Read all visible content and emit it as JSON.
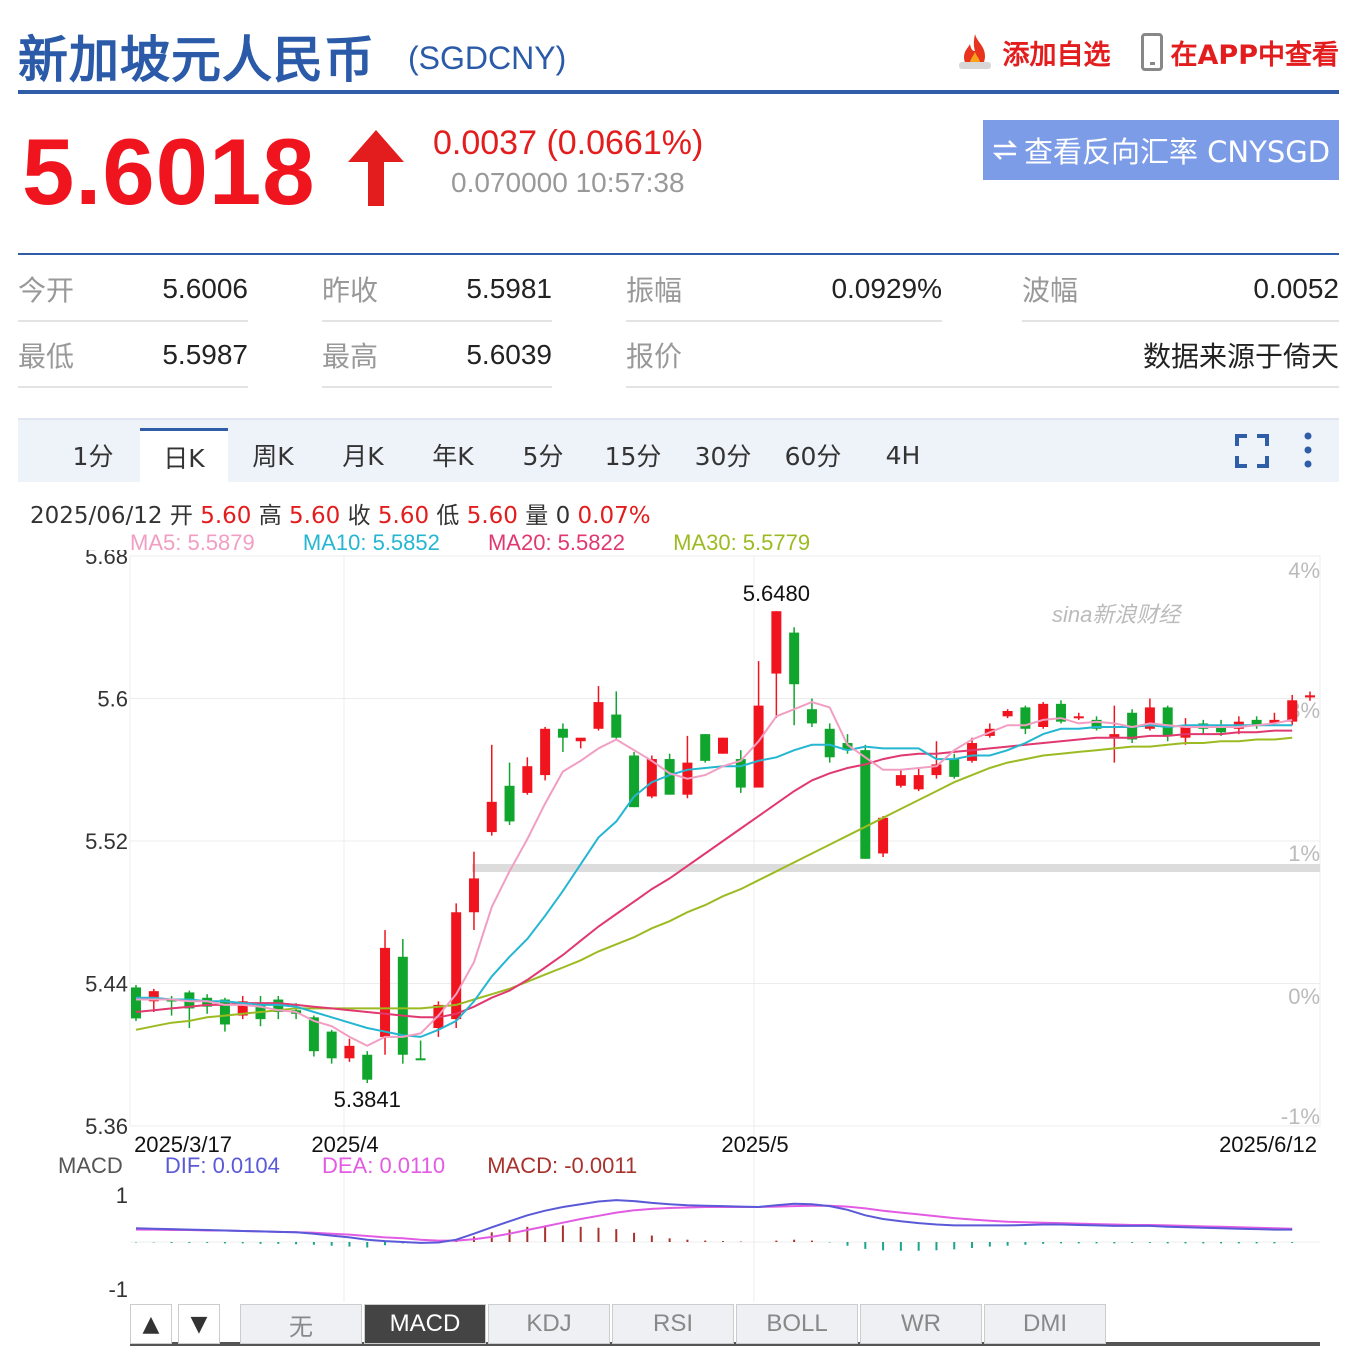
{
  "header": {
    "title": "新加坡元人民币",
    "symbol": "(SGDCNY)",
    "add_watch": "添加自选",
    "view_app": "在APP中查看"
  },
  "quote": {
    "price": "5.6018",
    "change": "0.0037 (0.0661%)",
    "sub": "0.070000 10:57:38",
    "reverse_button": "查看反向汇率 CNYSGD",
    "price_color": "#f0141e"
  },
  "stats": [
    {
      "label": "今开",
      "value": "5.6006"
    },
    {
      "label": "昨收",
      "value": "5.5981"
    },
    {
      "label": "振幅",
      "value": "0.0929%"
    },
    {
      "label": "波幅",
      "value": "0.0052"
    },
    {
      "label": "最低",
      "value": "5.5987"
    },
    {
      "label": "最高",
      "value": "5.6039"
    },
    {
      "label": "报价",
      "value": "数据来源于倚天"
    }
  ],
  "tabs": [
    "1分",
    "日K",
    "周K",
    "月K",
    "年K",
    "5分",
    "15分",
    "30分",
    "60分",
    "4H"
  ],
  "active_tab": "日K",
  "info": {
    "date": "2025/06/12",
    "open_label": "开",
    "open": "5.60",
    "high_label": "高",
    "high": "5.60",
    "close_label": "收",
    "close": "5.60",
    "low_label": "低",
    "low": "5.60",
    "vol_label": "量",
    "vol": "0",
    "pct": "0.07%"
  },
  "ma": {
    "ma5": "MA5: 5.5879",
    "ma10": "MA10: 5.5852",
    "ma20": "MA20: 5.5822",
    "ma30": "MA30: 5.5779",
    "colors": {
      "ma5": "#f19ec2",
      "ma10": "#25b6d2",
      "ma20": "#e0396f",
      "ma30": "#9cbb22"
    }
  },
  "chart_data": {
    "type": "candlestick",
    "y_ticks": [
      "5.68",
      "5.6",
      "5.52",
      "5.44",
      "5.36"
    ],
    "y_tick_values": [
      5.68,
      5.6,
      5.52,
      5.44,
      5.36
    ],
    "pct_ticks": [
      "4%",
      "3%",
      "1%",
      "0%",
      "-1%"
    ],
    "x_ticks": [
      "2025/3/17",
      "2025/4",
      "2025/5",
      "2025/6/12"
    ],
    "ylim": [
      5.36,
      5.68
    ],
    "annotations": {
      "max": "5.6480",
      "min": "5.3841"
    },
    "watermark": "sina新浪财经",
    "up_color": "#f0141e",
    "down_color": "#10a52c",
    "candles": [
      [
        5.4378,
        5.4204,
        5.4392,
        5.419
      ],
      [
        5.43,
        5.4357,
        5.437,
        5.424
      ],
      [
        5.431,
        5.43,
        5.433,
        5.422
      ],
      [
        5.435,
        5.426,
        5.436,
        5.415
      ],
      [
        5.432,
        5.427,
        5.434,
        5.423
      ],
      [
        5.431,
        5.417,
        5.432,
        5.413
      ],
      [
        5.422,
        5.43,
        5.433,
        5.42
      ],
      [
        5.429,
        5.42,
        5.433,
        5.416
      ],
      [
        5.431,
        5.424,
        5.433,
        5.42
      ],
      [
        5.425,
        5.423,
        5.429,
        5.42
      ],
      [
        5.421,
        5.402,
        5.422,
        5.399
      ],
      [
        5.413,
        5.398,
        5.414,
        5.395
      ],
      [
        5.398,
        5.405,
        5.409,
        5.396
      ],
      [
        5.4,
        5.386,
        5.402,
        5.3841
      ],
      [
        5.41,
        5.46,
        5.47,
        5.4
      ],
      [
        5.455,
        5.4,
        5.465,
        5.395
      ],
      [
        5.398,
        5.397,
        5.408,
        5.397
      ],
      [
        5.415,
        5.428,
        5.43,
        5.41
      ],
      [
        5.42,
        5.48,
        5.485,
        5.415
      ],
      [
        5.48,
        5.499,
        5.514,
        5.47
      ],
      [
        5.525,
        5.542,
        5.574,
        5.523
      ],
      [
        5.551,
        5.531,
        5.564,
        5.529
      ],
      [
        5.547,
        5.562,
        5.567,
        5.546
      ],
      [
        5.557,
        5.583,
        5.584,
        5.554
      ],
      [
        5.583,
        5.578,
        5.586,
        5.57
      ],
      [
        5.576,
        5.578,
        5.577,
        5.572
      ],
      [
        5.583,
        5.598,
        5.607,
        5.582
      ],
      [
        5.591,
        5.578,
        5.604,
        5.577
      ],
      [
        5.568,
        5.539,
        5.57,
        5.539
      ],
      [
        5.545,
        5.566,
        5.568,
        5.544
      ],
      [
        5.566,
        5.546,
        5.569,
        5.546
      ],
      [
        5.546,
        5.564,
        5.579,
        5.544
      ],
      [
        5.58,
        5.565,
        5.58,
        5.564
      ],
      [
        5.569,
        5.578,
        5.578,
        5.569
      ],
      [
        5.566,
        5.55,
        5.571,
        5.547
      ],
      [
        5.55,
        5.596,
        5.621,
        5.55
      ],
      [
        5.614,
        5.649,
        5.649,
        5.589
      ],
      [
        5.637,
        5.608,
        5.64,
        5.585
      ],
      [
        5.594,
        5.586,
        5.6,
        5.584
      ],
      [
        5.583,
        5.567,
        5.586,
        5.564
      ],
      [
        5.575,
        5.571,
        5.58,
        5.569
      ],
      [
        5.571,
        5.51,
        5.574,
        5.51
      ],
      [
        5.513,
        5.533,
        5.534,
        5.511
      ],
      [
        5.551,
        5.557,
        5.56,
        5.55
      ],
      [
        5.549,
        5.557,
        5.561,
        5.548
      ],
      [
        5.557,
        5.563,
        5.576,
        5.555
      ],
      [
        5.566,
        5.556,
        5.569,
        5.555
      ],
      [
        5.565,
        5.575,
        5.578,
        5.564
      ],
      [
        5.579,
        5.583,
        5.586,
        5.578
      ],
      [
        5.59,
        5.593,
        5.594,
        5.589
      ],
      [
        5.595,
        5.583,
        5.596,
        5.58
      ],
      [
        5.584,
        5.597,
        5.598,
        5.583
      ],
      [
        5.597,
        5.587,
        5.599,
        5.586
      ],
      [
        5.589,
        5.59,
        5.592,
        5.588
      ],
      [
        5.588,
        5.583,
        5.59,
        5.582
      ],
      [
        5.578,
        5.58,
        5.596,
        5.564
      ],
      [
        5.592,
        5.577,
        5.594,
        5.575
      ],
      [
        5.583,
        5.595,
        5.6,
        5.582
      ],
      [
        5.595,
        5.579,
        5.596,
        5.576
      ],
      [
        5.578,
        5.585,
        5.589,
        5.574
      ],
      [
        5.586,
        5.583,
        5.588,
        5.58
      ],
      [
        5.585,
        5.581,
        5.588,
        5.579
      ],
      [
        5.583,
        5.587,
        5.59,
        5.58
      ],
      [
        5.588,
        5.585,
        5.59,
        5.583
      ],
      [
        5.586,
        5.588,
        5.592,
        5.585
      ],
      [
        5.587,
        5.599,
        5.602,
        5.585
      ],
      [
        5.6006,
        5.6018,
        5.6039,
        5.5987
      ]
    ],
    "ma5": [
      5.431,
      5.431,
      5.431,
      5.43,
      5.43,
      5.428,
      5.428,
      5.427,
      5.425,
      5.424,
      5.419,
      5.416,
      5.41,
      5.405,
      5.41,
      5.41,
      5.412,
      5.422,
      5.434,
      5.452,
      5.483,
      5.503,
      5.521,
      5.541,
      5.559,
      5.565,
      5.572,
      5.577,
      5.571,
      5.565,
      5.558,
      5.555,
      5.557,
      5.562,
      5.565,
      5.576,
      5.59,
      5.594,
      5.598,
      5.595,
      5.574,
      5.567,
      5.56,
      5.56,
      5.561,
      5.562,
      5.571,
      5.577,
      5.581,
      5.585,
      5.585,
      5.588,
      5.589,
      5.586,
      5.587,
      5.586,
      5.584,
      5.586,
      5.585,
      5.584,
      5.584,
      5.584,
      5.584,
      5.585,
      5.586,
      5.588
    ],
    "ma10": [
      5.432,
      5.432,
      5.431,
      5.431,
      5.43,
      5.43,
      5.429,
      5.428,
      5.428,
      5.427,
      5.424,
      5.421,
      5.418,
      5.415,
      5.413,
      5.411,
      5.41,
      5.414,
      5.419,
      5.43,
      5.444,
      5.455,
      5.465,
      5.478,
      5.492,
      5.507,
      5.522,
      5.531,
      5.545,
      5.553,
      5.557,
      5.56,
      5.561,
      5.562,
      5.562,
      5.565,
      5.567,
      5.571,
      5.574,
      5.574,
      5.571,
      5.573,
      5.572,
      5.572,
      5.572,
      5.566,
      5.566,
      5.568,
      5.568,
      5.571,
      5.575,
      5.58,
      5.583,
      5.583,
      5.584,
      5.584,
      5.584,
      5.585,
      5.584,
      5.585,
      5.585,
      5.585,
      5.585,
      5.585,
      5.585,
      5.585
    ],
    "ma20": [
      5.424,
      5.425,
      5.426,
      5.427,
      5.428,
      5.428,
      5.429,
      5.429,
      5.429,
      5.428,
      5.427,
      5.426,
      5.425,
      5.424,
      5.423,
      5.422,
      5.421,
      5.421,
      5.423,
      5.427,
      5.432,
      5.436,
      5.442,
      5.449,
      5.456,
      5.464,
      5.472,
      5.479,
      5.486,
      5.493,
      5.499,
      5.506,
      5.513,
      5.52,
      5.527,
      5.534,
      5.541,
      5.548,
      5.554,
      5.558,
      5.561,
      5.563,
      5.566,
      5.568,
      5.569,
      5.569,
      5.57,
      5.571,
      5.572,
      5.573,
      5.574,
      5.575,
      5.576,
      5.577,
      5.578,
      5.578,
      5.578,
      5.579,
      5.579,
      5.58,
      5.58,
      5.58,
      5.581,
      5.581,
      5.582,
      5.582
    ],
    "ma30": [
      5.414,
      5.416,
      5.418,
      5.419,
      5.421,
      5.422,
      5.423,
      5.424,
      5.425,
      5.426,
      5.426,
      5.426,
      5.426,
      5.426,
      5.426,
      5.426,
      5.426,
      5.427,
      5.428,
      5.431,
      5.434,
      5.437,
      5.441,
      5.445,
      5.449,
      5.453,
      5.458,
      5.462,
      5.466,
      5.471,
      5.475,
      5.48,
      5.484,
      5.489,
      5.493,
      5.498,
      5.503,
      5.508,
      5.513,
      5.518,
      5.523,
      5.528,
      5.533,
      5.538,
      5.543,
      5.548,
      5.553,
      5.557,
      5.561,
      5.564,
      5.566,
      5.568,
      5.569,
      5.57,
      5.571,
      5.572,
      5.573,
      5.573,
      5.574,
      5.575,
      5.575,
      5.576,
      5.576,
      5.577,
      5.577,
      5.578
    ]
  },
  "macd": {
    "name": "MACD",
    "dif": "DIF: 0.0104",
    "dea": "DEA: 0.0110",
    "macd": "MACD: -0.0011",
    "y_ticks": [
      "1",
      "-1"
    ],
    "colors": {
      "dif": "#5a5ad8",
      "dea": "#e35be3",
      "pos": "#a8322e",
      "neg": "#1aa48b"
    },
    "dif_values": [
      0.3,
      0.29,
      0.28,
      0.27,
      0.26,
      0.25,
      0.24,
      0.23,
      0.22,
      0.21,
      0.18,
      0.14,
      0.1,
      0.05,
      0.02,
      0.0,
      -0.02,
      -0.01,
      0.05,
      0.18,
      0.32,
      0.45,
      0.58,
      0.68,
      0.76,
      0.82,
      0.88,
      0.91,
      0.89,
      0.85,
      0.82,
      0.8,
      0.79,
      0.78,
      0.77,
      0.76,
      0.8,
      0.83,
      0.82,
      0.78,
      0.7,
      0.58,
      0.5,
      0.45,
      0.41,
      0.38,
      0.36,
      0.36,
      0.36,
      0.36,
      0.37,
      0.38,
      0.38,
      0.37,
      0.36,
      0.35,
      0.35,
      0.35,
      0.33,
      0.32,
      0.31,
      0.3,
      0.29,
      0.28,
      0.27,
      0.27
    ],
    "dea_values": [
      0.27,
      0.27,
      0.26,
      0.26,
      0.25,
      0.25,
      0.24,
      0.23,
      0.22,
      0.21,
      0.2,
      0.18,
      0.16,
      0.13,
      0.1,
      0.08,
      0.05,
      0.03,
      0.03,
      0.06,
      0.11,
      0.18,
      0.26,
      0.34,
      0.42,
      0.5,
      0.57,
      0.64,
      0.69,
      0.72,
      0.74,
      0.75,
      0.76,
      0.76,
      0.76,
      0.76,
      0.77,
      0.78,
      0.79,
      0.79,
      0.77,
      0.73,
      0.68,
      0.64,
      0.6,
      0.56,
      0.52,
      0.49,
      0.46,
      0.44,
      0.43,
      0.42,
      0.41,
      0.4,
      0.39,
      0.38,
      0.37,
      0.37,
      0.36,
      0.35,
      0.34,
      0.33,
      0.32,
      0.31,
      0.3,
      0.29
    ],
    "hist_values": [
      -0.01,
      -0.01,
      -0.02,
      -0.02,
      -0.02,
      -0.03,
      -0.03,
      -0.04,
      -0.04,
      -0.05,
      -0.06,
      -0.08,
      -0.1,
      -0.12,
      -0.07,
      -0.03,
      -0.02,
      -0.01,
      0.04,
      0.12,
      0.21,
      0.27,
      0.33,
      0.36,
      0.36,
      0.33,
      0.31,
      0.28,
      0.2,
      0.14,
      0.08,
      0.05,
      0.03,
      0.02,
      0.01,
      0.0,
      0.03,
      0.05,
      0.03,
      -0.01,
      -0.08,
      -0.15,
      -0.18,
      -0.19,
      -0.19,
      -0.18,
      -0.16,
      -0.13,
      -0.1,
      -0.08,
      -0.06,
      -0.04,
      -0.03,
      -0.03,
      -0.03,
      -0.03,
      -0.02,
      -0.02,
      -0.03,
      -0.03,
      -0.03,
      -0.03,
      -0.03,
      -0.03,
      -0.03,
      -0.02
    ]
  },
  "indicators": [
    "无",
    "MACD",
    "KDJ",
    "RSI",
    "BOLL",
    "WR",
    "DMI"
  ],
  "active_indicator": "MACD",
  "nav": {
    "up": "▲",
    "down": "▼"
  }
}
